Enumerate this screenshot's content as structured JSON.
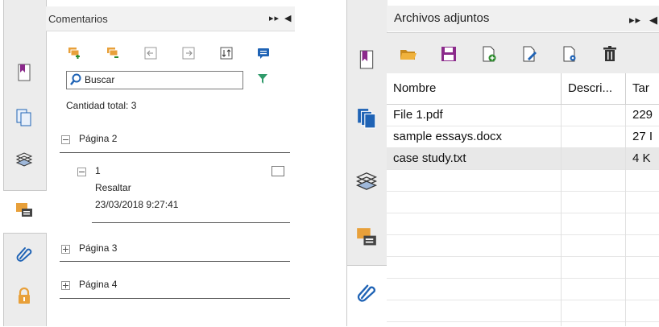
{
  "comments_panel": {
    "title": "Comentarios",
    "search_placeholder": "Buscar",
    "total_label": "Cantidad total: 3",
    "groups": [
      {
        "label": "Página 2",
        "expanded": true,
        "items": [
          {
            "number": "1",
            "type": "Resaltar",
            "date": "23/03/2018 9:27:41"
          }
        ]
      },
      {
        "label": "Página 3",
        "expanded": false
      },
      {
        "label": "Página 4",
        "expanded": false
      }
    ],
    "toolbar_icons": [
      "expand-all-icon",
      "collapse-all-icon",
      "previous-page-icon",
      "next-page-icon",
      "sort-icon",
      "add-comment-icon",
      "filter-icon"
    ]
  },
  "attachments_panel": {
    "title": "Archivos adjuntos",
    "toolbar_icons": [
      "open-folder-icon",
      "save-icon",
      "add-file-icon",
      "edit-file-icon",
      "file-settings-icon",
      "delete-icon"
    ],
    "columns": [
      "Nombre",
      "Descri...",
      "Tar"
    ],
    "rows": [
      {
        "name": "File 1.pdf",
        "description": "",
        "size": "229"
      },
      {
        "name": "sample essays.docx",
        "description": "",
        "size": "27 I"
      },
      {
        "name": "case study.txt",
        "description": "",
        "size": "4 K"
      }
    ],
    "selected_row": 2
  },
  "header_glyphs": {
    "fast_forward": "⏩",
    "collapse": "◀"
  },
  "colors": {
    "accent_green": "#5a9a2a",
    "accent_purple": "#8b2a8b",
    "accent_orange": "#e8a03a",
    "accent_blue": "#1f63b5"
  }
}
